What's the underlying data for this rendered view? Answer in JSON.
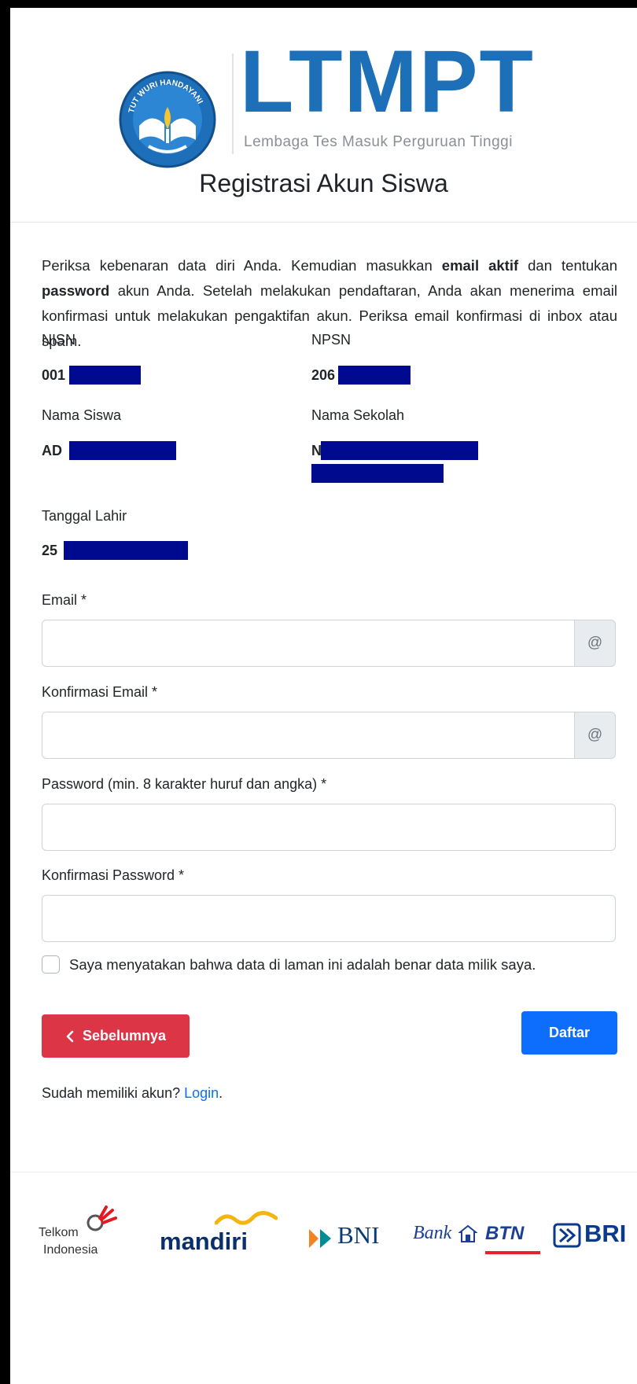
{
  "header": {
    "brand_name": "LTMPT",
    "brand_tagline": "Lembaga Tes Masuk Perguruan Tinggi",
    "emblem_text": "TUT WURI HANDAYANI",
    "page_title": "Registrasi Akun Siswa"
  },
  "intro": {
    "part1": "Periksa kebenaran data diri Anda. Kemudian masukkan ",
    "bold1": "email aktif",
    "part2": " dan tentukan ",
    "bold2": "password",
    "part3": " akun Anda. Setelah melakukan pendaftaran, Anda akan menerima email konfirmasi untuk melakukan pengaktifan akun. Periksa email konfirmasi di inbox atau spam."
  },
  "student": {
    "nisn_label": "NISN",
    "nisn_value": "001",
    "npsn_label": "NPSN",
    "npsn_value": "206",
    "name_label": "Nama Siswa",
    "name_value": "AD",
    "school_label": "Nama Sekolah",
    "school_value": "N",
    "birth_label": "Tanggal Lahir",
    "birth_value": "25"
  },
  "form": {
    "email_label": "Email *",
    "email_value": "",
    "email_addon": "@",
    "confirm_email_label": "Konfirmasi Email *",
    "confirm_email_value": "",
    "confirm_email_addon": "@",
    "password_label": "Password (min. 8 karakter huruf dan angka) *",
    "password_value": "",
    "confirm_password_label": "Konfirmasi Password *",
    "confirm_password_value": "",
    "agreement_label": "Saya menyatakan bahwa data di laman ini adalah benar data milik saya.",
    "agreement_checked": false
  },
  "actions": {
    "prev_label": "Sebelumnya",
    "submit_label": "Daftar",
    "login_prompt": "Sudah memiliki akun? ",
    "login_link": "Login",
    "login_suffix": "."
  },
  "partners": {
    "telkom_line1": "Telkom",
    "telkom_line2": "Indonesia",
    "mandiri": "mandiri",
    "bni": "BNI",
    "btn_bank": "Bank",
    "btn_name": "BTN",
    "bri": "BRI"
  },
  "colors": {
    "brand_blue": "#1d6fb8",
    "danger": "#dc3545",
    "primary": "#0d6efd",
    "redaction": "#000a8f"
  }
}
